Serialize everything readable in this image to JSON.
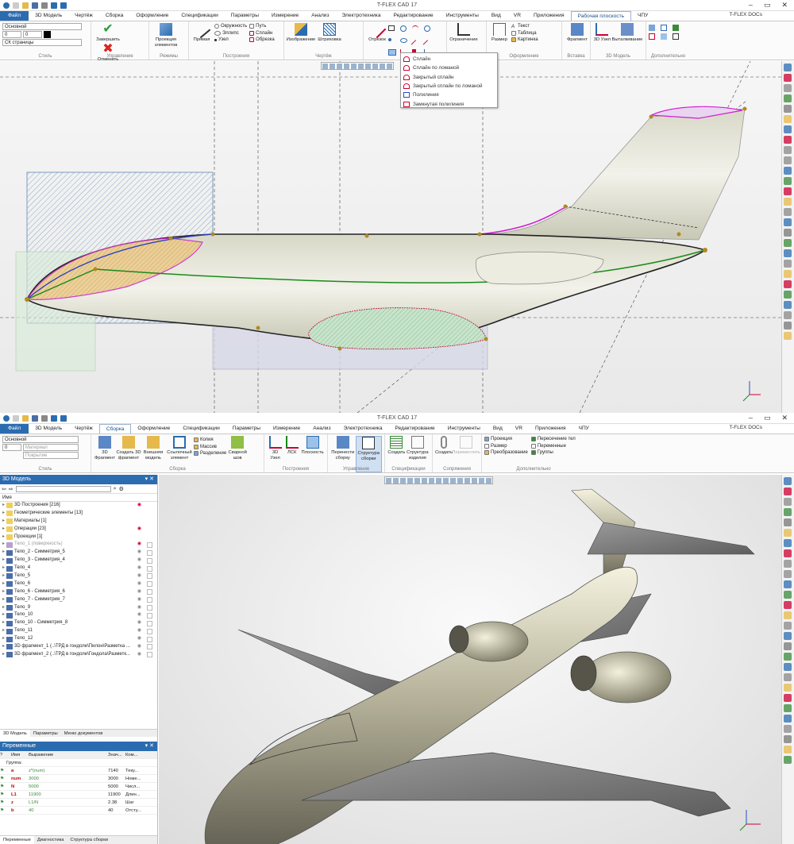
{
  "app_title": "T-FLEX CAD 17",
  "docs_label": "T-FLEX DOCs",
  "menu_top": [
    "Файл",
    "3D Модель",
    "Чертёж",
    "Сборка",
    "Оформление",
    "Спецификации",
    "Параметры",
    "Измерение",
    "Анализ",
    "Электротехника",
    "Редактирование",
    "Инструменты",
    "Вид",
    "VR",
    "Приложения",
    "Рабочая плоскость",
    "ЧПУ"
  ],
  "menu_top_active": "Рабочая плоскость",
  "ribbon_top": {
    "style": {
      "layer": "Основной",
      "num1": "0",
      "num2": "0",
      "cs": "СК страницы",
      "group": "Стиль"
    },
    "control": {
      "finish": "Завершить",
      "cancel": "Отменить",
      "group": "Управление"
    },
    "modes": {
      "proj": "Проекция элементов",
      "group": "Режимы"
    },
    "build": {
      "line": "Прямая",
      "circle": "Окружность",
      "ellipse": "Эллипс",
      "node": "Узел",
      "path": "Путь",
      "spline": "Сплайн",
      "trim": "Обрезка",
      "group": "Построения"
    },
    "drawing": {
      "image": "Изображение",
      "hatch": "Штриховка",
      "segment": "Отрезок",
      "group": "Чертёж"
    },
    "format": {
      "constraint": "Ограничение",
      "size": "Размер",
      "text": "Текст",
      "table": "Таблица",
      "picture": "Картинка",
      "group": "Оформление"
    },
    "insert": {
      "fragment": "Фрагмент",
      "group": "Вставка"
    },
    "model3d": {
      "node": "3D Узел",
      "extrude": "Выталкивание",
      "group": "3D Модель"
    },
    "extra": {
      "group": "Дополнительно"
    }
  },
  "spline_menu": [
    "Сплайн",
    "Сплайн по ломаной",
    "Закрытый сплайн",
    "Закрытый сплайн по ломаной",
    "Полилиния",
    "Замкнутая полилиния"
  ],
  "menu_bottom": [
    "Файл",
    "3D Модель",
    "Чертёж",
    "Сборка",
    "Оформление",
    "Спецификации",
    "Параметры",
    "Измерение",
    "Анализ",
    "Электротехника",
    "Редактирование",
    "Инструменты",
    "Вид",
    "VR",
    "Приложения",
    "ЧПУ"
  ],
  "menu_bottom_active": "Сборка",
  "ribbon_bottom": {
    "style": {
      "layer": "Основной",
      "num": "0",
      "material": "Материал",
      "cover": "Покрытие",
      "group": "Стиль"
    },
    "assembly": {
      "frag3d": "3D Фрагмент",
      "create3d": "Создать 3D фрагмент",
      "extmodel": "Внешняя модель",
      "refel": "Ссылочный элемент",
      "copy": "Копия",
      "mass": "Массив",
      "split": "Разделение",
      "weld": "Сварной шов",
      "group": "Сборка"
    },
    "build": {
      "node3d": "3D Узел",
      "lsk": "ЛСК",
      "plane": "Плоскость",
      "group": "Построения"
    },
    "control": {
      "move": "Перенести сборку",
      "struct": "Структура сборки",
      "group": "Управление"
    },
    "spec": {
      "create": "Создать",
      "structure": "Структура изделия",
      "group": "Спецификации"
    },
    "mate": {
      "create": "Создать",
      "move": "Переместить",
      "group": "Сопряжения"
    },
    "extra": {
      "proj": "Проекция",
      "size": "Размер",
      "transform": "Преобразование",
      "intersect": "Пересечение тел",
      "vars": "Переменные",
      "groups": "Группы",
      "group": "Дополнительно"
    }
  },
  "model_panel": {
    "title": "3D Модель",
    "col_name": "Имя",
    "tree": [
      "3D Построения [216]",
      "Геометрические элементы [13]",
      "Материалы [1]",
      "Операции [23]",
      "Проекции [1]",
      "Тело_1 (поверхность)",
      "Тело_2 - Симметрия_5",
      "Тело_3 - Симметрия_4",
      "Тело_4",
      "Тело_5",
      "Тело_6",
      "Тело_6 - Симметрия_6",
      "Тело_7 - Симметрия_7",
      "Тело_9",
      "Тело_10",
      "Тело_10 - Симметрия_8",
      "Тело_11",
      "Тело_12",
      "3D фрагмент_1 (..\\ТРД в гондоле\\Пилон\\Разметка ...",
      "3D фрагмент_2 (..\\ТРД в гондоле\\Гондола\\Разметк..."
    ],
    "tabs": [
      "3D Модель",
      "Параметры",
      "Меню документов"
    ]
  },
  "vars_panel": {
    "title": "Переменные",
    "cols": [
      "Имя",
      "Выражение",
      "Знач...",
      "Ком..."
    ],
    "group_label": "Группа:",
    "rows": [
      {
        "name": "a",
        "expr": "z*(num)",
        "val": "7140",
        "com": "Теку..."
      },
      {
        "name": "num",
        "expr": "3000",
        "val": "3000",
        "com": "Номе..."
      },
      {
        "name": "N",
        "expr": "5000",
        "val": "5000",
        "com": "Числ..."
      },
      {
        "name": "L1",
        "expr": "11900",
        "val": "11900",
        "com": "Длин..."
      },
      {
        "name": "z",
        "expr": "L1/N",
        "val": "2.38",
        "com": "Шаг"
      },
      {
        "name": "b",
        "expr": "40",
        "val": "40",
        "com": "Отсту..."
      }
    ],
    "tabs": [
      "Переменные",
      "Диагностика",
      "Структура сборки"
    ]
  }
}
